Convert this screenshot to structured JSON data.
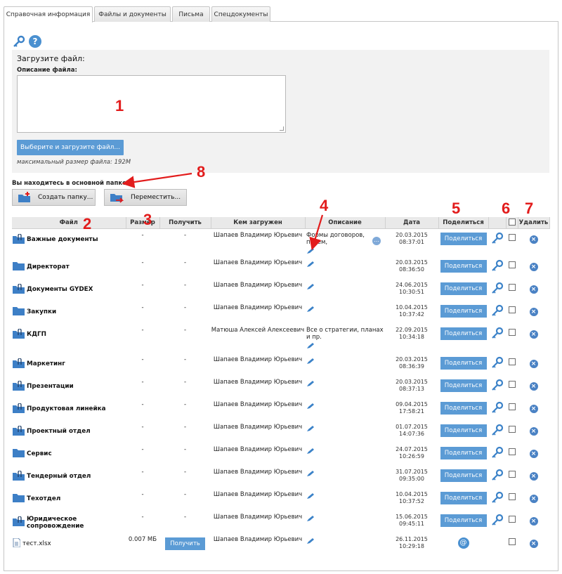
{
  "tabs": [
    "Справочная информация",
    "Файлы и документы",
    "Письма",
    "Спецдокументы"
  ],
  "upload": {
    "title": "Загрузите файл:",
    "desc_label": "Описание файла:",
    "button": "Выберите и загрузите файл...",
    "max_size": "максимальный размер файла: 192M"
  },
  "location_text": "Вы находитесь в основной папке:",
  "actions": {
    "create_folder": "Создать папку...",
    "move": "Переместить..."
  },
  "table": {
    "headers": [
      "Файл",
      "Размер",
      "Получить",
      "Кем загружен",
      "Описание",
      "Дата",
      "Поделиться",
      "",
      "",
      "Удалить"
    ],
    "share_label": "Поделиться",
    "rows": [
      {
        "name": "Важные документы",
        "icon": "folder-clip",
        "size": "-",
        "get": "-",
        "who": "Шапаев Владимир Юрьевич",
        "desc": "Формы договоров, писем,",
        "date": "20.03.2015",
        "time": "08:37:01"
      },
      {
        "name": "Директорат",
        "icon": "folder",
        "size": "-",
        "get": "-",
        "who": "Шапаев Владимир Юрьевич",
        "desc": "",
        "date": "20.03.2015",
        "time": "08:36:50"
      },
      {
        "name": "Документы GYDEX",
        "icon": "folder-clip",
        "size": "-",
        "get": "-",
        "who": "Шапаев Владимир Юрьевич",
        "desc": "",
        "date": "24.06.2015",
        "time": "10:30:51"
      },
      {
        "name": "Закупки",
        "icon": "folder",
        "size": "-",
        "get": "-",
        "who": "Шапаев Владимир Юрьевич",
        "desc": "",
        "date": "10.04.2015",
        "time": "10:37:42"
      },
      {
        "name": "КДГП",
        "icon": "folder-clip",
        "size": "-",
        "get": "-",
        "who": "Матюша Алексей Алексеевич",
        "desc": "Все о стратегии, планах и пр.",
        "date": "22.09.2015",
        "time": "10:34:18"
      },
      {
        "name": "Маркетинг",
        "icon": "folder-clip",
        "size": "-",
        "get": "-",
        "who": "Шапаев Владимир Юрьевич",
        "desc": "",
        "date": "20.03.2015",
        "time": "08:36:39"
      },
      {
        "name": "Презентации",
        "icon": "folder-clip",
        "size": "-",
        "get": "-",
        "who": "Шапаев Владимир Юрьевич",
        "desc": "",
        "date": "20.03.2015",
        "time": "08:37:13"
      },
      {
        "name": "Продуктовая линейка",
        "icon": "folder-clip",
        "size": "-",
        "get": "-",
        "who": "Шапаев Владимир Юрьевич",
        "desc": "",
        "date": "09.04.2015",
        "time": "17:58:21"
      },
      {
        "name": "Проектный отдел",
        "icon": "folder-clip",
        "size": "-",
        "get": "-",
        "who": "Шапаев Владимир Юрьевич",
        "desc": "",
        "date": "01.07.2015",
        "time": "14:07:36"
      },
      {
        "name": "Сервис",
        "icon": "folder",
        "size": "-",
        "get": "-",
        "who": "Шапаев Владимир Юрьевич",
        "desc": "",
        "date": "24.07.2015",
        "time": "10:26:59"
      },
      {
        "name": "Тендерный отдел",
        "icon": "folder-clip",
        "size": "-",
        "get": "-",
        "who": "Шапаев Владимир Юрьевич",
        "desc": "",
        "date": "31.07.2015",
        "time": "09:35:00"
      },
      {
        "name": "Техотдел",
        "icon": "folder",
        "size": "-",
        "get": "-",
        "who": "Шапаев Владимир Юрьевич",
        "desc": "",
        "date": "10.04.2015",
        "time": "10:37:52"
      },
      {
        "name": "Юридическое сопровождение",
        "icon": "folder-clip",
        "size": "-",
        "get": "-",
        "who": "Шапаев Владимир Юрьевич",
        "desc": "",
        "date": "15.06.2015",
        "time": "09:45:11"
      },
      {
        "name": "тест.xlsx",
        "icon": "file",
        "size": "0.007 МБ",
        "get": "Получить",
        "who": "Шапаев Владимир Юрьевич",
        "desc": "",
        "date": "26.11.2015",
        "time": "10:29:18"
      }
    ]
  },
  "annotations": [
    "1",
    "2",
    "3",
    "4",
    "5",
    "6",
    "7",
    "8"
  ],
  "colors": {
    "accent": "#5b9bd5",
    "annotation": "#e21c1c",
    "folder": "#3d7fc6"
  }
}
